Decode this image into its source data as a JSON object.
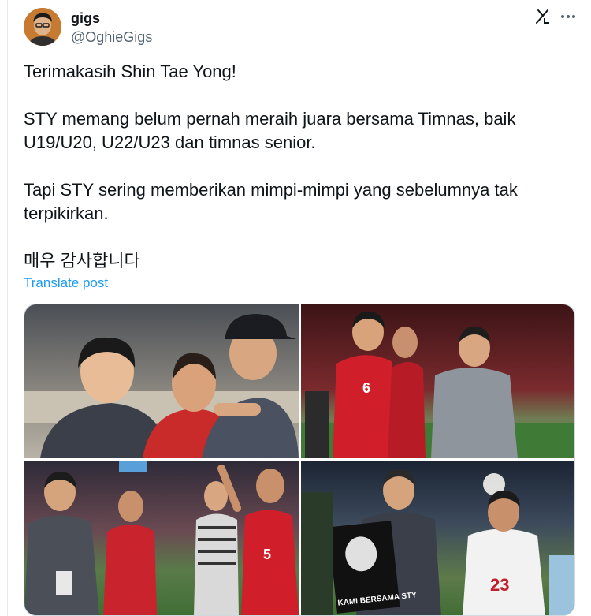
{
  "post": {
    "author_name": "gigs",
    "author_handle": "@OghieGigs",
    "paragraphs": [
      "Terimakasih Shin Tae Yong!",
      "STY memang belum pernah meraih juara bersama Timnas, baik U19/U20, U22/U23 dan timnas senior.",
      "Tapi STY sering memberikan mimpi-mimpi yang sebelumnya tak terpikirkan.",
      "매우 감사합니다"
    ],
    "translate_label": "Translate post",
    "jersey_numbers": [
      "6",
      "5",
      "23"
    ],
    "poster_text": "KAMI BERSAMA STY"
  },
  "icons": {
    "grok": "grok-icon",
    "more": "more-icon"
  },
  "colors": {
    "accent": "#1d9bf0",
    "secondary_text": "#536471",
    "jersey_red": "#d01f2b"
  }
}
